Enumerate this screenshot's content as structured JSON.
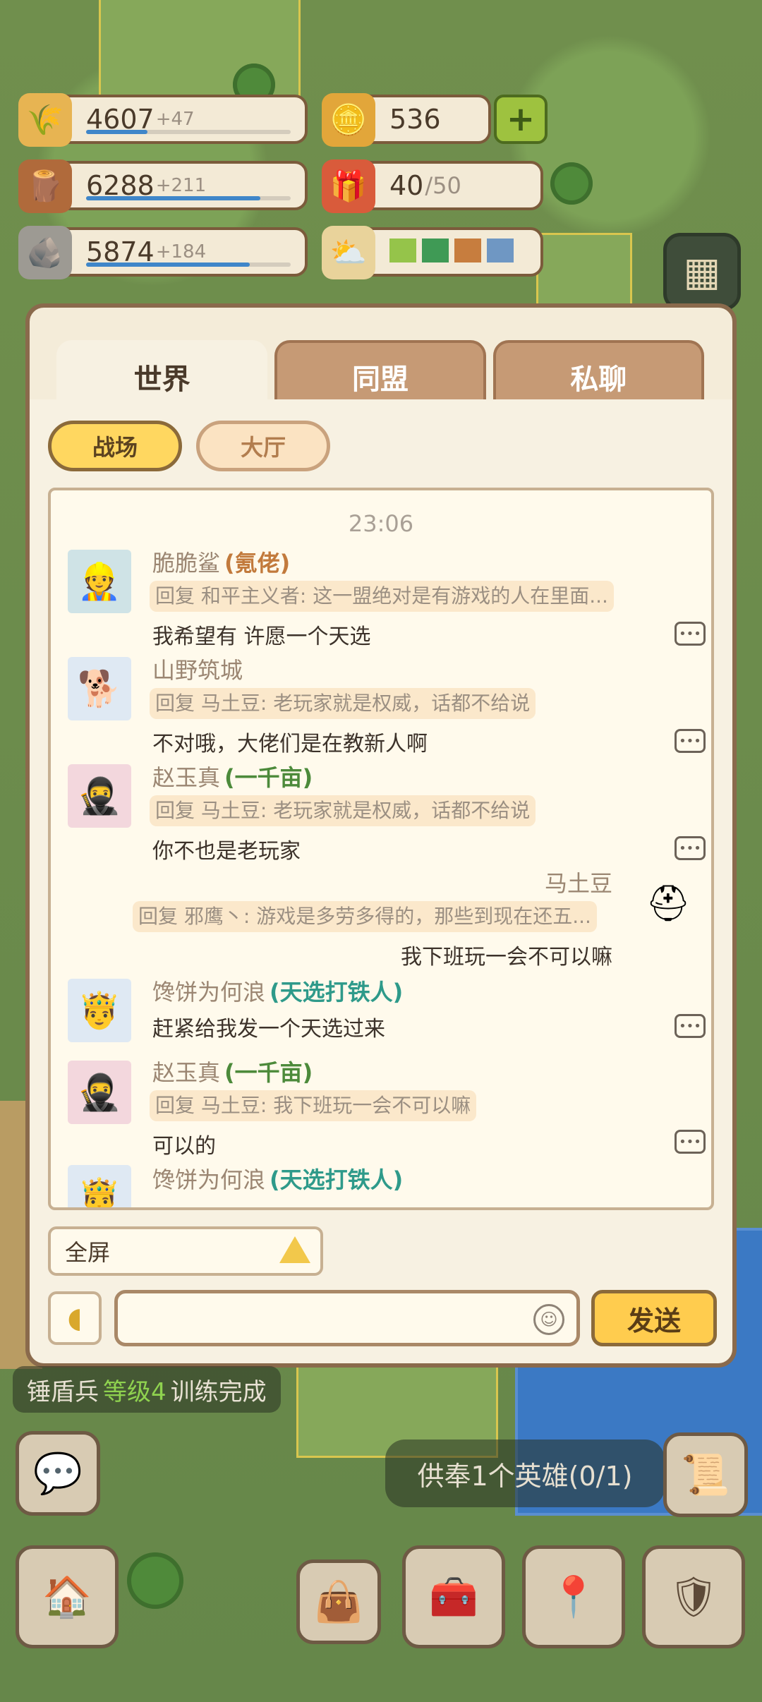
{
  "resources": {
    "food": {
      "value": "4607",
      "delta": "+47",
      "fill": 0.3
    },
    "wood": {
      "value": "6288",
      "delta": "+211",
      "fill": 0.85
    },
    "stone": {
      "value": "5874",
      "delta": "+184",
      "fill": 0.8
    },
    "gold": {
      "value": "536"
    },
    "gift": {
      "value": "40",
      "max": "/50"
    }
  },
  "tabs": [
    "世界",
    "同盟",
    "私聊"
  ],
  "subtabs": [
    "战场",
    "大厅"
  ],
  "chat": {
    "time": "23:06",
    "messages": [
      {
        "name": "脆脆鲨",
        "title": "(氪佬)",
        "title_color": "#c27a3c",
        "reply": "回复 和平主义者: 这一盟绝对是有游戏的人在里面...",
        "text": "我希望有 许愿一个天选"
      },
      {
        "name": "山野筑城",
        "title": "",
        "reply": "回复 马土豆: 老玩家就是权威，话都不给说",
        "text": "不对哦，大佬们是在教新人啊"
      },
      {
        "name": "赵玉真",
        "title": "(一千亩)",
        "title_color": "#4c8a3a",
        "reply": "回复 马土豆: 老玩家就是权威，话都不给说",
        "text": "你不也是老玩家"
      },
      {
        "name": "马土豆",
        "title": "",
        "reply": "回复 邪鹰丶: 游戏是多劳多得的，那些到现在还五...",
        "text": "我下班玩一会不可以嘛",
        "self": true
      },
      {
        "name": "馋饼为何浪",
        "title": "(天选打铁人)",
        "title_color": "#2e9a8a",
        "reply": "",
        "text": "赶紧给我发一个天选过来"
      },
      {
        "name": "赵玉真",
        "title": "(一千亩)",
        "title_color": "#4c8a3a",
        "reply": "回复 马土豆: 我下班玩一会不可以嘛",
        "text": "可以的"
      },
      {
        "name": "馋饼为何浪",
        "title": "(天选打铁人)",
        "title_color": "#2e9a8a",
        "reply": "",
        "text": ""
      }
    ]
  },
  "fullscreen_label": "全屏",
  "send_label": "发送",
  "input": {
    "value": "",
    "placeholder": ""
  },
  "toast": {
    "unit": "锤盾兵",
    "level": "等级4",
    "status": "训练完成"
  },
  "task": "供奉1个英雄(0/1)",
  "colors": {
    "panel_border": "#8a6a4c",
    "send_button": "#ffcc4e",
    "active_subtab": "#ffd760"
  }
}
